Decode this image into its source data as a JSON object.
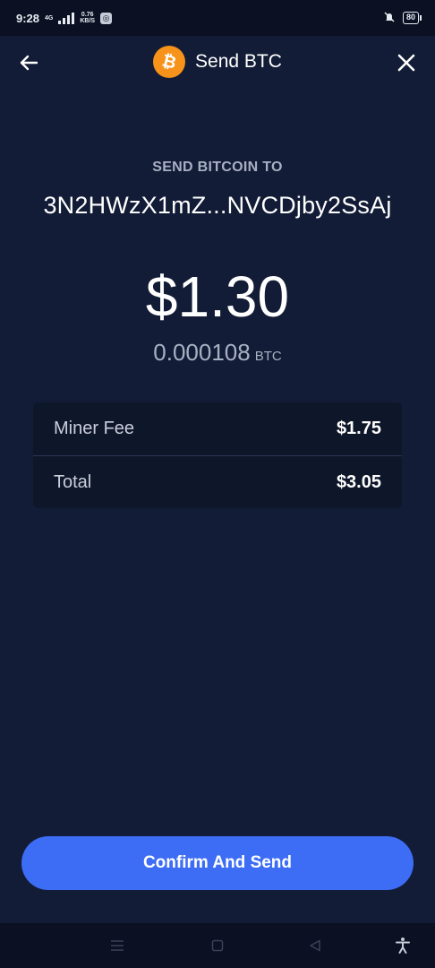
{
  "status_bar": {
    "time": "9:28",
    "network": "4G",
    "speed_value": "0.76",
    "speed_unit": "KB/S",
    "battery": "80",
    "icons": [
      "signal-icon",
      "app-notification-icon",
      "mute-icon",
      "battery-icon"
    ]
  },
  "header": {
    "title": "Send BTC",
    "back_icon": "arrow-left-icon",
    "close_icon": "close-icon",
    "logo_icon": "bitcoin-icon",
    "logo_color": "#f7931a"
  },
  "recipient": {
    "label": "SEND BITCOIN TO",
    "address": "3N2HWzX1mZ...NVCDjby2SsAj"
  },
  "amount": {
    "usd": "$1.30",
    "btc_value": "0.000108",
    "btc_unit": "BTC"
  },
  "fees": [
    {
      "label": "Miner Fee",
      "value": "$1.75"
    },
    {
      "label": "Total",
      "value": "$3.05"
    }
  ],
  "confirm_button": {
    "label": "Confirm And Send",
    "color": "#3d6df5"
  },
  "nav_bar": {
    "icons": [
      "menu-icon",
      "home-square-icon",
      "back-triangle-icon",
      "accessibility-icon"
    ]
  },
  "colors": {
    "background": "#121c36",
    "card": "#0e1629",
    "muted_text": "#a9b0c3"
  }
}
